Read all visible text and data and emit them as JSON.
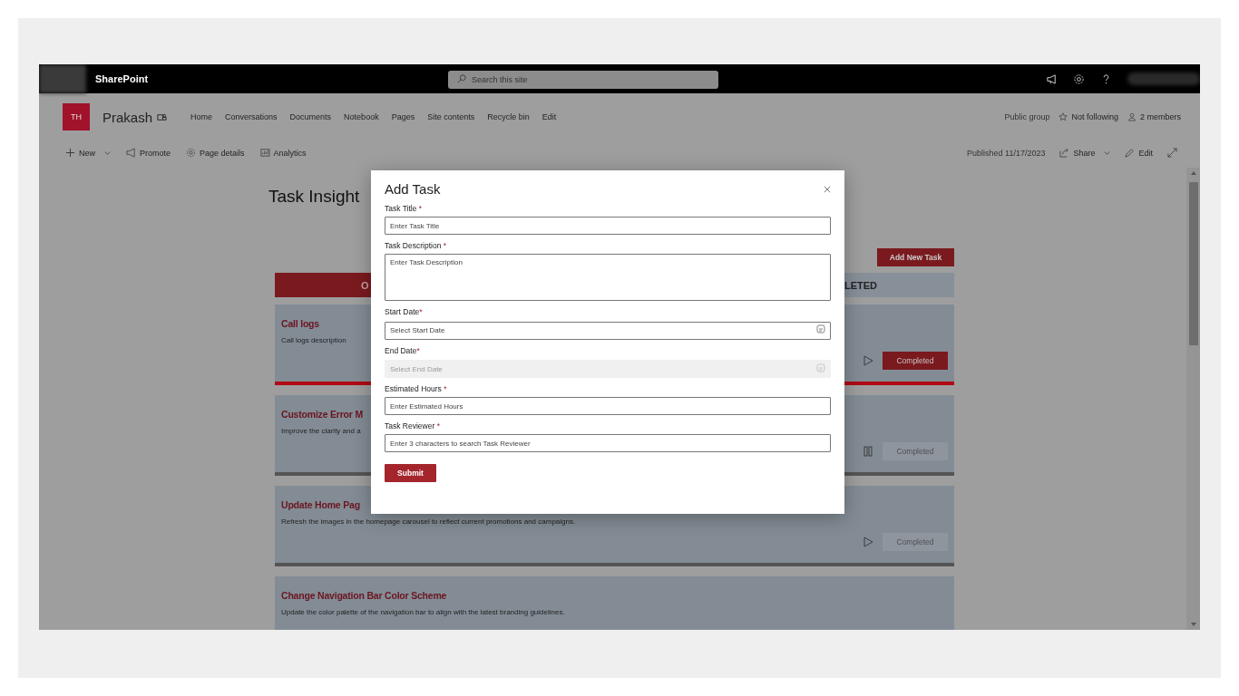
{
  "top_bar": {
    "app_name": "SharePoint",
    "search_placeholder": "Search this site"
  },
  "site": {
    "logo": "TH",
    "name": "Prakash",
    "nav": [
      "Home",
      "Conversations",
      "Documents",
      "Notebook",
      "Pages",
      "Site contents",
      "Recycle bin",
      "Edit"
    ],
    "group_type": "Public group",
    "follow": "Not following",
    "members": "2 members"
  },
  "command_bar": {
    "left": [
      {
        "kind": "new",
        "label": "New"
      },
      {
        "kind": "promote",
        "label": "Promote"
      },
      {
        "kind": "details",
        "label": "Page details"
      },
      {
        "kind": "analytics",
        "label": "Analytics"
      }
    ],
    "published": "Published 11/17/2023",
    "share": "Share",
    "edit": "Edit"
  },
  "page": {
    "title": "Task Insight",
    "add_button": "Add New Task",
    "tabs": [
      {
        "label": "O",
        "selected": true
      },
      {
        "label": "LETED",
        "selected": false
      }
    ],
    "cards": [
      {
        "title": "Call logs",
        "description": "Call logs description",
        "kind": "play",
        "active": true,
        "button": "Completed"
      },
      {
        "title": "Customize Error M",
        "description": "Improve the clarity and a",
        "kind": "pause",
        "active": false,
        "button": "Completed"
      },
      {
        "title": "Update Home Pag",
        "description": "Refresh the images in the homepage carousel to reflect current promotions and campaigns.",
        "kind": "play",
        "active": false,
        "button": "Completed"
      },
      {
        "title": "Change Navigation Bar Color Scheme",
        "description": "Update the color palette of the navigation bar to align with the latest branding guidelines."
      }
    ]
  },
  "modal": {
    "title": "Add Task",
    "submit": "Submit",
    "fields": [
      {
        "label": "Task Title",
        "required_mark": " *",
        "kind": "text",
        "placeholder": "Enter Task Title",
        "disabled": false
      },
      {
        "label": "Task Description",
        "required_mark": " *",
        "kind": "textarea",
        "placeholder": "Enter Task Description",
        "disabled": false
      },
      {
        "label": "Start Date",
        "required_mark": "*",
        "kind": "date",
        "placeholder": "Select Start Date",
        "disabled": false
      },
      {
        "label": "End Date",
        "required_mark": "*",
        "kind": "date",
        "placeholder": "Select End Date",
        "disabled": true
      },
      {
        "label": "Estimated Hours",
        "required_mark": " *",
        "kind": "text",
        "placeholder": "Enter Estimated Hours",
        "disabled": false
      },
      {
        "label": "Task Reviewer",
        "required_mark": " *",
        "kind": "text",
        "placeholder": "Enter 3 characters to search Task Reviewer",
        "disabled": false
      }
    ]
  }
}
